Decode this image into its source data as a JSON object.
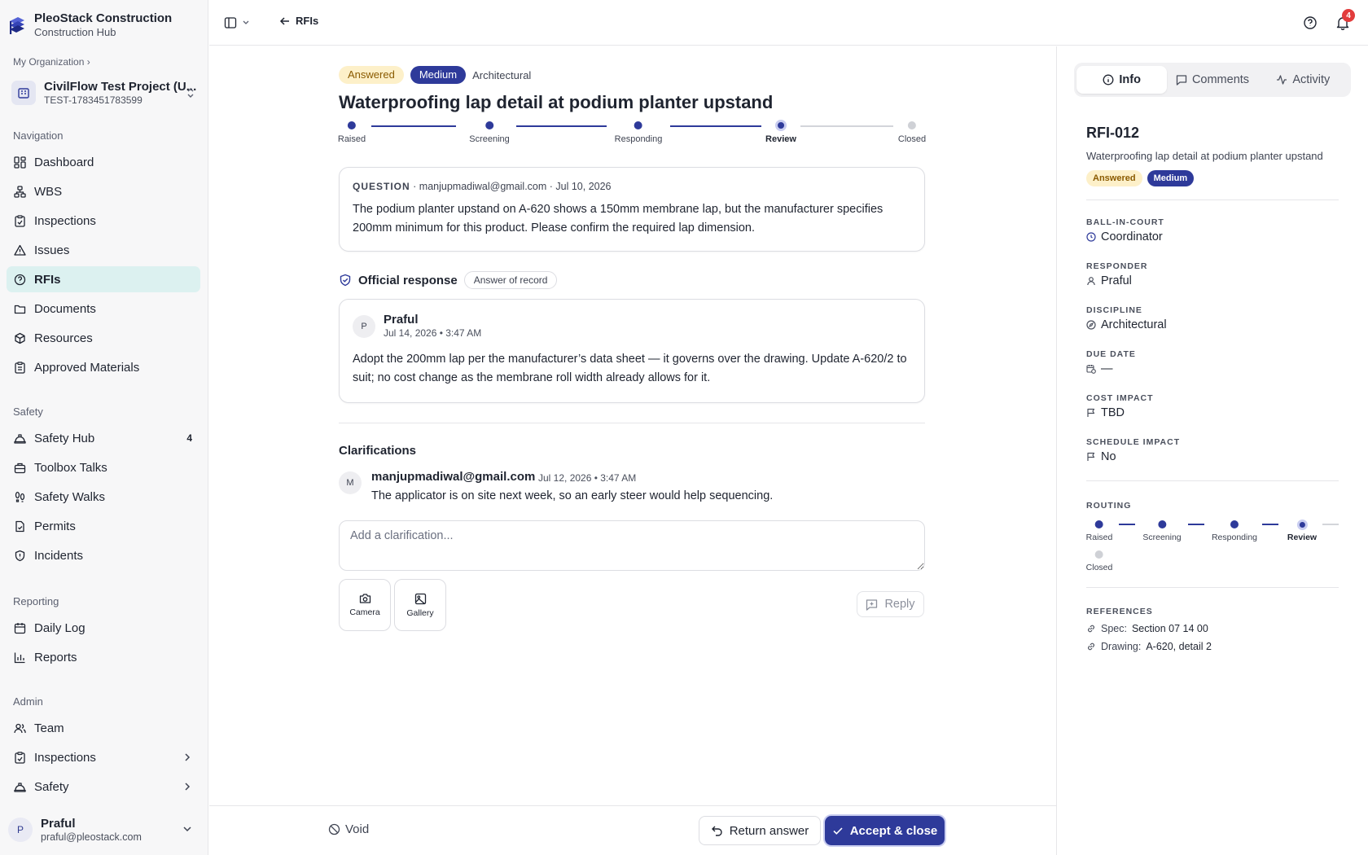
{
  "brand": {
    "name": "PleoStack Construction",
    "subtitle": "Construction Hub"
  },
  "org_link": "My Organization ›",
  "project": {
    "name": "CivilFlow Test Project (U...",
    "id": "TEST-1783451783599"
  },
  "sidebar": {
    "sections": {
      "navigation": "Navigation",
      "safety": "Safety",
      "reporting": "Reporting",
      "admin": "Admin"
    },
    "navigation": [
      {
        "label": "Dashboard",
        "icon": "dashboard-icon"
      },
      {
        "label": "WBS",
        "icon": "wbs-icon"
      },
      {
        "label": "Inspections",
        "icon": "clipboard-check-icon"
      },
      {
        "label": "Issues",
        "icon": "warning-triangle-icon"
      },
      {
        "label": "RFIs",
        "icon": "question-circle-icon",
        "active": true
      },
      {
        "label": "Documents",
        "icon": "folder-icon"
      },
      {
        "label": "Resources",
        "icon": "package-icon"
      },
      {
        "label": "Approved Materials",
        "icon": "clipboard-list-icon"
      }
    ],
    "safety": [
      {
        "label": "Safety Hub",
        "badge": "4",
        "icon": "hard-hat-icon"
      },
      {
        "label": "Toolbox Talks",
        "icon": "briefcase-icon"
      },
      {
        "label": "Safety Walks",
        "icon": "footprints-icon"
      },
      {
        "label": "Permits",
        "icon": "file-check-icon"
      },
      {
        "label": "Incidents",
        "icon": "shield-alert-icon"
      }
    ],
    "reporting": [
      {
        "label": "Daily Log",
        "icon": "calendar-icon"
      },
      {
        "label": "Reports",
        "icon": "bar-chart-icon"
      }
    ],
    "admin": [
      {
        "label": "Team",
        "icon": "users-icon"
      },
      {
        "label": "Inspections",
        "icon": "clipboard-check-icon"
      },
      {
        "label": "Safety",
        "icon": "hard-hat-icon"
      }
    ]
  },
  "user": {
    "initial": "P",
    "name": "Praful",
    "email": "praful@pleostack.com"
  },
  "topbar": {
    "back_label": "RFIs",
    "notification_count": "4"
  },
  "rfi": {
    "status": "Answered",
    "priority": "Medium",
    "discipline": "Architectural",
    "title": "Waterproofing lap detail at podium planter upstand",
    "steps": [
      "Raised",
      "Screening",
      "Responding",
      "Review",
      "Closed"
    ],
    "current_step_index": 3,
    "question": {
      "label": "QUESTION",
      "meta": "· manjupmadiwal@gmail.com · Jul 10, 2026",
      "body": "The podium planter upstand on A-620 shows a 150mm membrane lap, but the manufacturer specifies 200mm minimum for this product. Please confirm the required lap dimension."
    },
    "official_response": {
      "label": "Official response",
      "tag": "Answer of record",
      "initial": "P",
      "author": "Praful",
      "date": "Jul 14, 2026 • 3:47 AM",
      "body": "Adopt the 200mm lap per the manufacturer’s data sheet — it governs over the drawing. Update A-620/2 to suit; no cost change as the membrane roll width already allows for it."
    },
    "clarifications": {
      "title": "Clarifications",
      "items": [
        {
          "initial": "M",
          "author": "manjupmadiwal@gmail.com",
          "date": "Jul 12, 2026 • 3:47 AM",
          "text": "The applicator is on site next week, so an early steer would help sequencing."
        }
      ],
      "placeholder": "Add a clarification...",
      "camera_label": "Camera",
      "gallery_label": "Gallery",
      "reply_label": "Reply"
    }
  },
  "footer": {
    "void_label": "Void",
    "return_label": "Return answer",
    "accept_label": "Accept & close"
  },
  "panel": {
    "tabs": [
      "Info",
      "Comments",
      "Activity"
    ],
    "active_tab": "Info",
    "rfi_id": "RFI-012",
    "subtitle": "Waterproofing lap detail at podium planter upstand",
    "status": "Answered",
    "priority": "Medium",
    "fields": [
      {
        "label": "BALL-IN-COURT",
        "value": "Coordinator",
        "icon": "clock-icon"
      },
      {
        "label": "RESPONDER",
        "value": "Praful",
        "icon": "user-icon"
      },
      {
        "label": "DISCIPLINE",
        "value": "Architectural",
        "icon": "compass-icon"
      },
      {
        "label": "DUE DATE",
        "value": "—",
        "icon": "calendar-clock-icon"
      },
      {
        "label": "COST IMPACT",
        "value": "TBD",
        "icon": "flag-icon"
      },
      {
        "label": "SCHEDULE IMPACT",
        "value": "No",
        "icon": "flag-icon"
      }
    ],
    "routing_label": "ROUTING",
    "references_label": "REFERENCES",
    "references": [
      {
        "key": "Spec:",
        "value": "Section 07 14 00"
      },
      {
        "key": "Drawing:",
        "value": "A-620, detail 2"
      }
    ]
  },
  "colors": {
    "accent": "#2e3a9a",
    "answered_bg": "#fdf0c9",
    "answered_fg": "#8a5a00",
    "active_nav_bg": "#dcf1f0",
    "badge_red": "#e23c3c"
  }
}
